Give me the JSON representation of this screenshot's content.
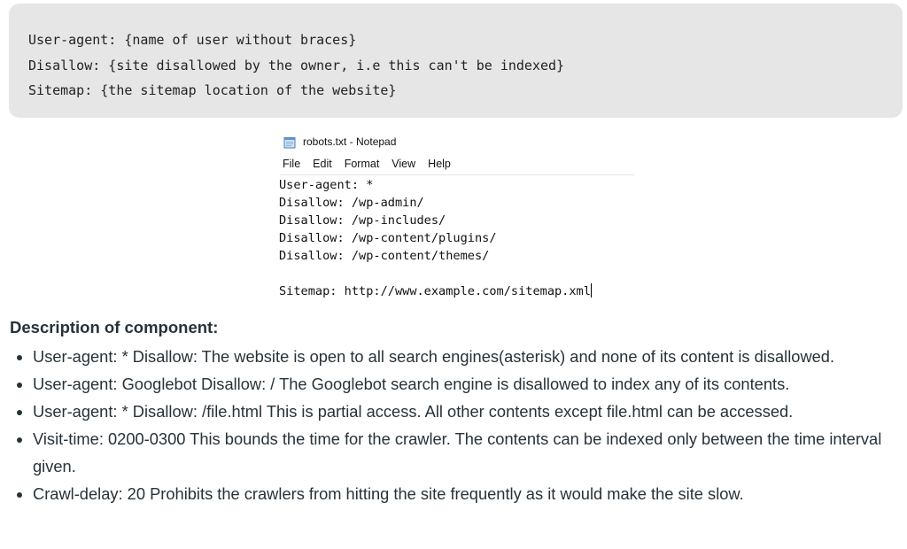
{
  "code_block": {
    "lines": [
      "User-agent: {name of user without braces}",
      "Disallow: {site disallowed by the owner, i.e this can't be indexed}",
      "Sitemap: {the sitemap location of the website}"
    ]
  },
  "notepad": {
    "title": "robots.txt - Notepad",
    "icon": "notepad-icon",
    "menu": [
      "File",
      "Edit",
      "Format",
      "View",
      "Help"
    ],
    "content_lines": [
      "User-agent: *",
      "Disallow: /wp-admin/",
      "Disallow: /wp-includes/",
      "Disallow: /wp-content/plugins/",
      "Disallow: /wp-content/themes/",
      "",
      "Sitemap: http://www.example.com/sitemap.xml"
    ]
  },
  "description": {
    "heading": "Description of component:",
    "items": [
      "User-agent: * Disallow: The website is open to all search engines(asterisk) and none of its content is disallowed.",
      "User-agent: Googlebot Disallow: / The Googlebot search engine is disallowed to index any of its contents.",
      "User-agent: * Disallow: /file.html This is partial access. All other contents except file.html can be accessed.",
      "Visit-time: 0200-0300 This bounds the time for the crawler. The contents can be indexed only between the time interval given.",
      "Crawl-delay: 20 Prohibits the crawlers from hitting the site frequently as it would make the site slow."
    ]
  }
}
